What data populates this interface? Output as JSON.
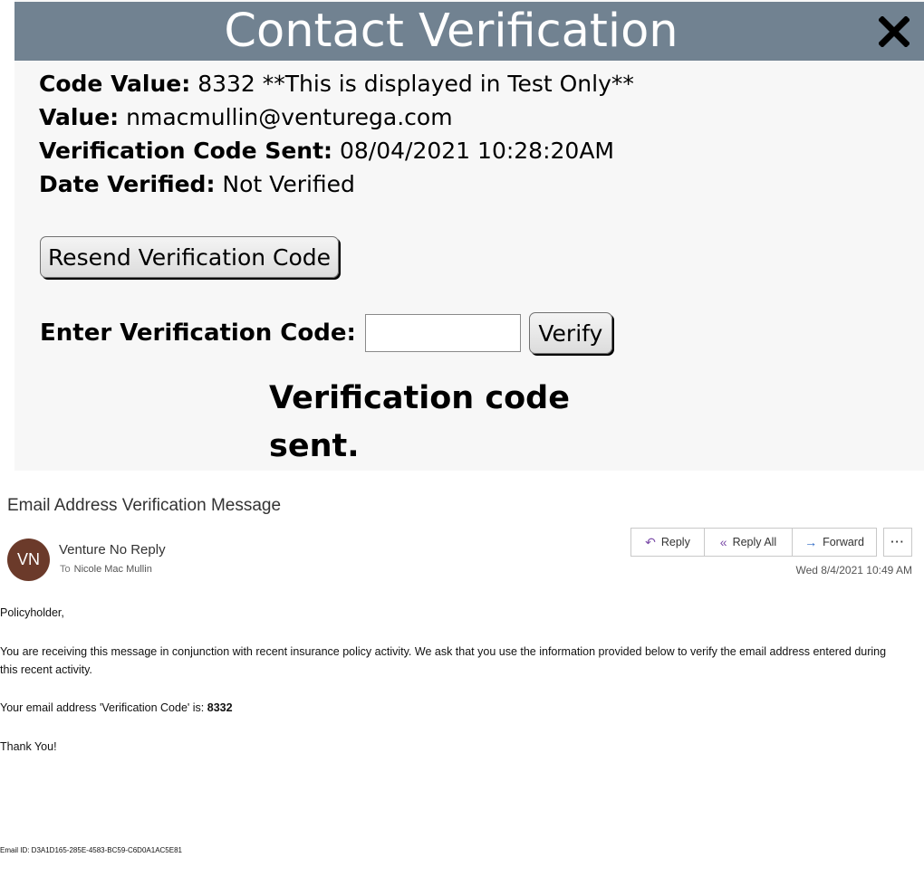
{
  "dialog": {
    "title": "Contact Verification",
    "fields": {
      "code_value_label": "Code Value:",
      "code_value": "8332 **This is displayed in Test Only**",
      "value_label": "Value:",
      "value": "nmacmullin@venturega.com",
      "code_sent_label": "Verification Code Sent:",
      "code_sent": "08/04/2021 10:28:20AM",
      "date_verified_label": "Date Verified:",
      "date_verified": "Not Verified"
    },
    "resend_button": "Resend Verification Code",
    "enter_code_label": "Enter Verification Code:",
    "code_input_value": "",
    "verify_button": "Verify",
    "status_message": "Verification code sent."
  },
  "email": {
    "subject": "Email Address Verification Message",
    "avatar_initials": "VN",
    "avatar_color": "#6b3a2a",
    "sender": "Venture No Reply",
    "to_label": "To",
    "recipient": "Nicole Mac Mullin",
    "actions": {
      "reply": "Reply",
      "reply_all": "Reply All",
      "forward": "Forward",
      "more": "···"
    },
    "timestamp": "Wed 8/4/2021 10:49 AM",
    "greeting": "Policyholder,",
    "paragraph": "You are receiving this message in conjunction with recent insurance policy activity. We ask that you use the information provided below to verify the email address entered during this recent activity.",
    "code_line_prefix": "Your email address 'Verification Code' is: ",
    "code": "8332",
    "thanks": "Thank You!",
    "email_id": "Email ID: D3A1D165-285E-4583-BC59-C6D0A1AC5E81"
  }
}
